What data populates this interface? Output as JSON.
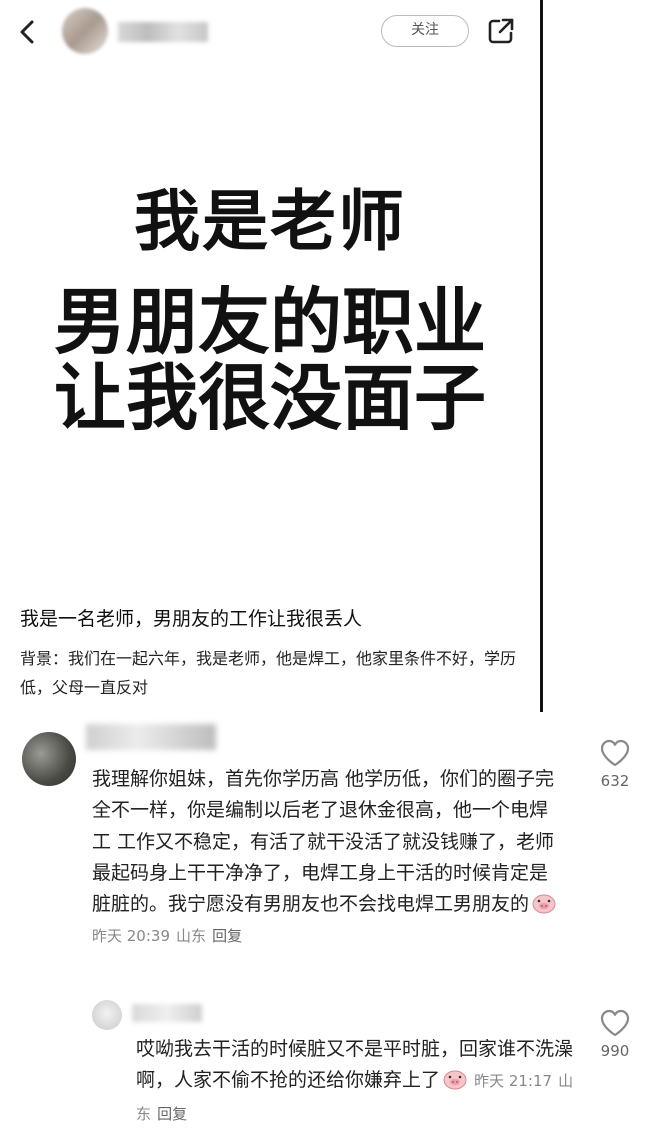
{
  "header": {
    "follow_label": "关注"
  },
  "hero": {
    "line1": "我是老师",
    "line2": "男朋友的职业",
    "line3": "让我很没面子"
  },
  "post": {
    "title": "我是一名老师，男朋友的工作让我很丢人",
    "body": "背景：我们在一起六年，我是老师，他是焊工，他家里条件不好，学历低，父母一直反对"
  },
  "comment": {
    "text": "我理解你姐妹，首先你学历高 他学历低，你们的圈子完全不一样，你是编制以后老了退休金很高，他一个电焊工 工作又不稳定，有活了就干没活了就没钱赚了，老师最起码身上干干净净了，电焊工身上干活的时候肯定是脏脏的。我宁愿没有男朋友也不会找电焊工男朋友的",
    "time": "昨天 20:39",
    "location": "山东",
    "reply_label": "回复",
    "likes": "632"
  },
  "reply": {
    "text": "哎呦我去干活的时候脏又不是平时脏，回家谁不洗澡啊，人家不偷不抢的还给你嫌弃上了",
    "time": "昨天 21:17",
    "location": "山东",
    "reply_label": "回复",
    "likes": "990"
  },
  "colors": {
    "like_outline": "#888888",
    "meta_text": "#888888",
    "follow_border": "#bbbbbb"
  },
  "icons": [
    "back-icon",
    "share-icon",
    "heart-icon",
    "pig-emoji-icon"
  ]
}
